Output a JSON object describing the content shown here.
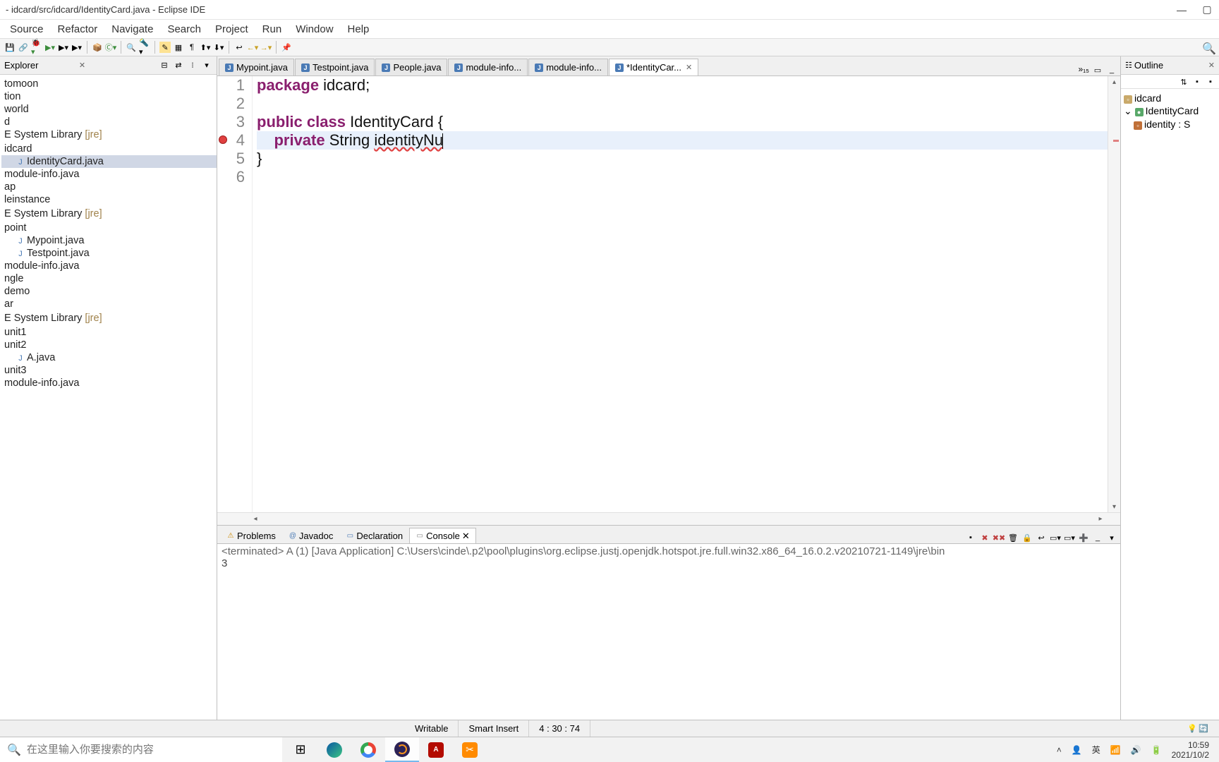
{
  "title": "- idcard/src/idcard/IdentityCard.java - Eclipse IDE",
  "menu": [
    "Source",
    "Refactor",
    "Navigate",
    "Search",
    "Project",
    "Run",
    "Window",
    "Help"
  ],
  "explorer": {
    "title": "Explorer",
    "items": [
      {
        "label": "tomoon",
        "icon": ""
      },
      {
        "label": "tion",
        "icon": ""
      },
      {
        "label": "world",
        "icon": ""
      },
      {
        "label": "d",
        "icon": ""
      },
      {
        "label": "E System Library ",
        "lib": "[jre]",
        "icon": ""
      },
      {
        "label": "",
        "icon": ""
      },
      {
        "label": "idcard",
        "icon": ""
      },
      {
        "label": "IdentityCard.java",
        "icon": "J",
        "sel": true,
        "indent": 1
      },
      {
        "label": "module-info.java",
        "icon": ""
      },
      {
        "label": "ap",
        "icon": ""
      },
      {
        "label": "leinstance",
        "icon": ""
      },
      {
        "label": "",
        "icon": ""
      },
      {
        "label": "E System Library ",
        "lib": "[jre]",
        "icon": ""
      },
      {
        "label": "",
        "icon": ""
      },
      {
        "label": "point",
        "icon": ""
      },
      {
        "label": "Mypoint.java",
        "icon": "J",
        "indent": 1
      },
      {
        "label": "Testpoint.java",
        "icon": "J",
        "indent": 1
      },
      {
        "label": "module-info.java",
        "icon": ""
      },
      {
        "label": "ngle",
        "icon": ""
      },
      {
        "label": "demo",
        "icon": ""
      },
      {
        "label": "ar",
        "icon": ""
      },
      {
        "label": "",
        "icon": ""
      },
      {
        "label": "E System Library ",
        "lib": "[jre]",
        "icon": ""
      },
      {
        "label": "",
        "icon": ""
      },
      {
        "label": "unit1",
        "icon": ""
      },
      {
        "label": "unit2",
        "icon": ""
      },
      {
        "label": "A.java",
        "icon": "J",
        "indent": 1
      },
      {
        "label": "unit3",
        "icon": ""
      },
      {
        "label": "module-info.java",
        "icon": ""
      }
    ]
  },
  "tabs": [
    {
      "label": "Mypoint.java"
    },
    {
      "label": "Testpoint.java"
    },
    {
      "label": "People.java"
    },
    {
      "label": "module-info..."
    },
    {
      "label": "module-info..."
    },
    {
      "label": "*IdentityCar...",
      "active": true
    },
    {
      "label": "",
      "overflow": true
    }
  ],
  "overflow_count": "»₁₅",
  "code": {
    "lines": [
      {
        "n": "1",
        "frags": [
          {
            "t": "package ",
            "c": "kw"
          },
          {
            "t": "idcard;"
          }
        ]
      },
      {
        "n": "2",
        "frags": []
      },
      {
        "n": "3",
        "frags": [
          {
            "t": "public class ",
            "c": "kw"
          },
          {
            "t": "IdentityCard {"
          }
        ]
      },
      {
        "n": "4",
        "err": true,
        "hl": true,
        "frags": [
          {
            "t": "    "
          },
          {
            "t": "private ",
            "c": "kw"
          },
          {
            "t": "String "
          },
          {
            "t": "identityNu",
            "c": "ident-err"
          }
        ]
      },
      {
        "n": "5",
        "frags": [
          {
            "t": "}"
          }
        ]
      },
      {
        "n": "6",
        "frags": []
      }
    ]
  },
  "outline": {
    "title": "Outline",
    "items": [
      {
        "label": "idcard",
        "icon": "▫",
        "color": "#c9a96a"
      },
      {
        "label": "IdentityCard",
        "icon": "●",
        "color": "#59a869",
        "expand": "⌄"
      },
      {
        "label": "identity : S",
        "icon": "▫",
        "color": "#c07038",
        "indent": 1
      }
    ]
  },
  "bottom": {
    "tabs": [
      {
        "label": "Problems",
        "icon": "⚠",
        "color": "#cc8800"
      },
      {
        "label": "Javadoc",
        "icon": "@",
        "color": "#4a7ab5"
      },
      {
        "label": "Declaration",
        "icon": "▭",
        "color": "#4a7ab5"
      },
      {
        "label": "Console",
        "icon": "▭",
        "color": "#888",
        "active": true
      }
    ],
    "term_line": "<terminated> A (1) [Java Application] C:\\Users\\cinde\\.p2\\pool\\plugins\\org.eclipse.justj.openjdk.hotspot.jre.full.win32.x86_64_16.0.2.v20210721-1149\\jre\\bin",
    "output": "3"
  },
  "status": {
    "mode": "Writable",
    "insert": "Smart Insert",
    "pos": "4 : 30 : 74"
  },
  "taskbar": {
    "search_placeholder": "在这里输入你要搜索的内容",
    "time": "10:59",
    "date": "2021/10/2",
    "ime": "英"
  }
}
